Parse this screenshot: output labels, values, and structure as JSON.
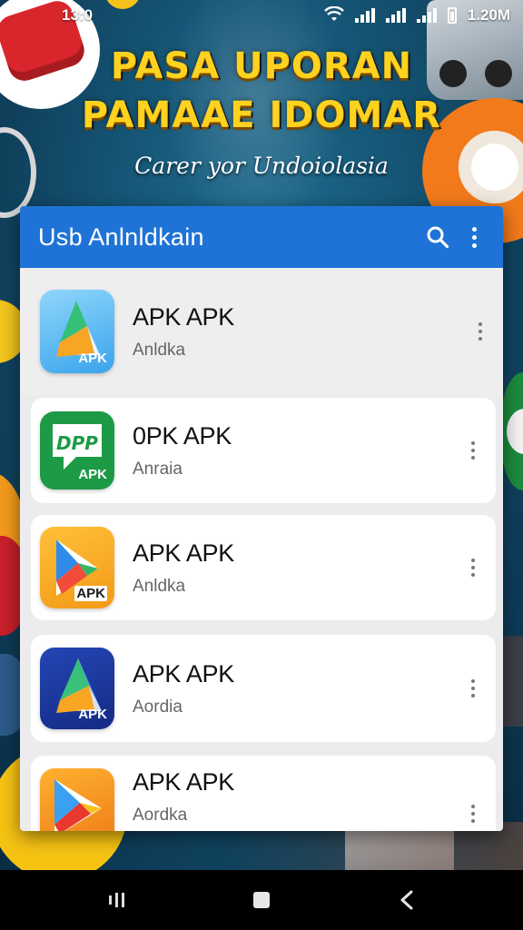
{
  "status_bar": {
    "time": "13:0",
    "right_text": "1.20M",
    "icons": [
      "wifi-icon",
      "signal-icon",
      "signal-icon",
      "data-signal-icon",
      "battery-icon"
    ]
  },
  "poster": {
    "title_line1": "PASA UPORAN",
    "title_line2": "PAMAAE IDOMAR",
    "subtitle": "Carer yor Undoiolasia",
    "colors": {
      "title": "#ffd21f",
      "background": "#165676"
    }
  },
  "app_bar": {
    "title": "Usb Anlnldkain",
    "search_icon": "search-icon",
    "menu_icon": "more-vert-icon",
    "color": "#1f73d6"
  },
  "apps": [
    {
      "name": "APK APK",
      "subtitle": "Anldka",
      "icon_label": "APK",
      "icon": "blue-triangle-icon",
      "icon_color": "#5cb8f2"
    },
    {
      "name": "0PK APK",
      "subtitle": "Anraia",
      "icon_label": "APK",
      "icon": "green-dpp-icon",
      "icon_color": "#1c9a46",
      "icon_text": "DPP"
    },
    {
      "name": "APK APK",
      "subtitle": "Anldka",
      "icon_label": "APK",
      "icon": "orange-play-icon",
      "icon_color": "#f7a51e"
    },
    {
      "name": "APK APK",
      "subtitle": "Aordia",
      "icon_label": "APK",
      "icon": "navy-triangle-icon",
      "icon_color": "#1a3b9c"
    },
    {
      "name": "APK APK",
      "subtitle": "Aordka",
      "icon_label": "",
      "icon": "orange-play-store-icon",
      "icon_color": "#f28a1c"
    }
  ],
  "nav_bar": {
    "recents_icon": "recents-icon",
    "home_icon": "home-icon",
    "back_icon": "back-icon"
  }
}
